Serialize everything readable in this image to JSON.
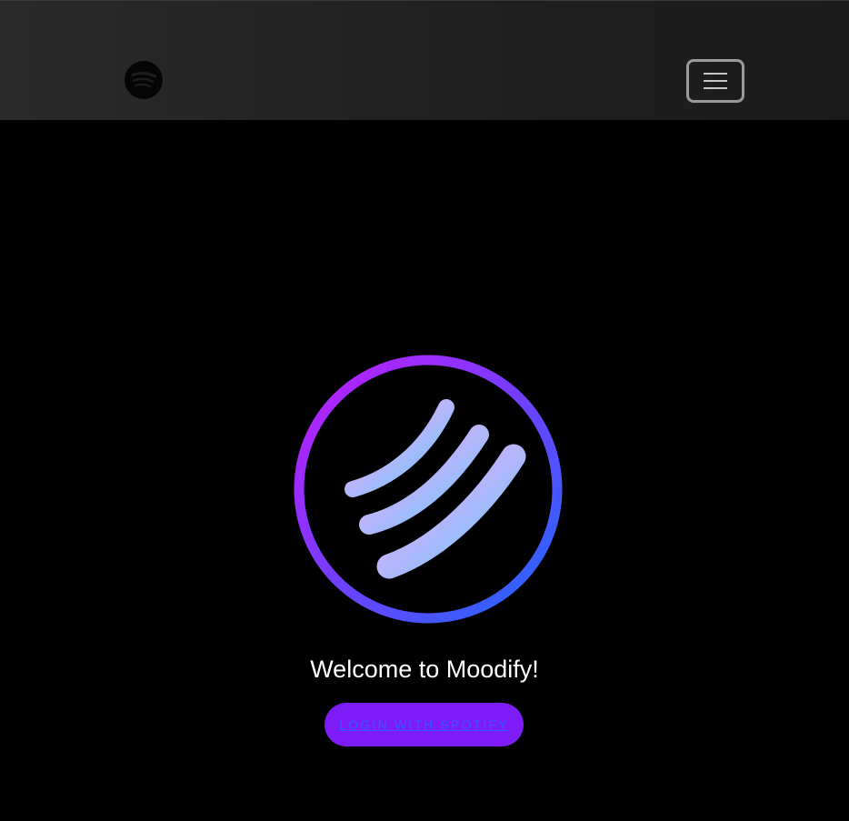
{
  "navbar": {
    "brand_icon": "spotify-logo-icon",
    "menu_icon": "hamburger-menu-icon"
  },
  "hero": {
    "logo_icon": "moodify-logo-icon",
    "welcome_text": "Welcome to Moodify!",
    "login_label": "LOGIN WITH SPOTIFY"
  },
  "colors": {
    "page_background": "#000000",
    "navbar_background": "#222222",
    "button_background": "#7d1cf6",
    "button_text": "#2f5bff",
    "ring_gradient_start": "#b51cff",
    "ring_gradient_end": "#1f6bff",
    "wave_gradient_start": "#e3adf7",
    "wave_gradient_end": "#6ecbff"
  }
}
